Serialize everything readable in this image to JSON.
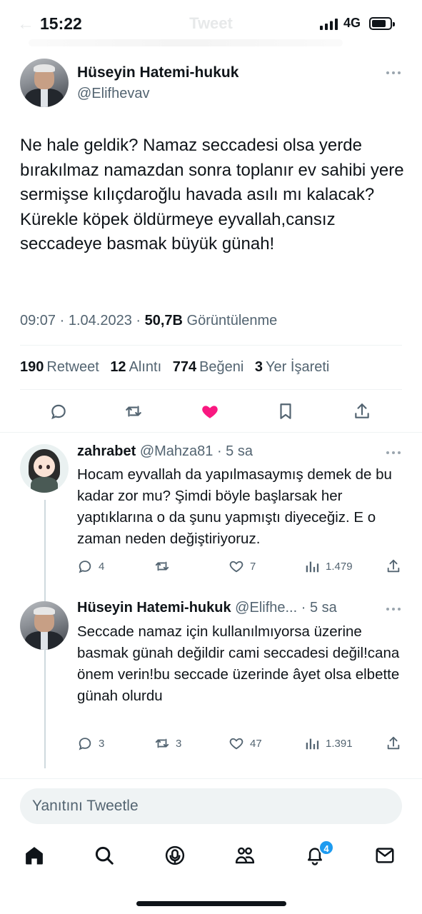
{
  "status_bar": {
    "time": "15:22",
    "network": "4G",
    "ghost_title": "Tweet"
  },
  "tweet": {
    "author_name": "Hüseyin Hatemi-hukuk",
    "author_handle": "@Elifhevav",
    "text": "Ne hale geldik? Namaz seccadesi olsa yerde bırakılmaz namazdan sonra toplanır ev sahibi yere sermişse kılıçdaroğlu havada asılı mı kalacak? Kürekle köpek öldürmeye eyvallah,cansız seccadeye basmak büyük günah!",
    "time": "09:07",
    "date": "1.04.2023",
    "views_count": "50,7B",
    "views_label": "Görüntülenme",
    "retweets_count": "190",
    "retweets_label": "Retweet",
    "quotes_count": "12",
    "quotes_label": "Alıntı",
    "likes_count": "774",
    "likes_label": "Beğeni",
    "bookmarks_count": "3",
    "bookmarks_label": "Yer İşareti"
  },
  "replies": [
    {
      "author_name": "zahrabet",
      "author_handle": "@Mahza81",
      "age": "5 sa",
      "text": "Hocam eyvallah da yapılmasaymış demek de bu kadar zor mu? Şimdi böyle başlarsak her yaptıklarına o da şunu yapmıştı diyeceğiz. E o zaman neden değiştiriyoruz.",
      "replies": "4",
      "retweets": "",
      "likes": "7",
      "views": "1.479"
    },
    {
      "author_name": "Hüseyin Hatemi-hukuk",
      "author_handle": "@Elifhe...",
      "age": "5 sa",
      "text": "Seccade namaz için kullanılmıyorsa üzerine basmak günah değildir cami seccadesi değil!cana önem verin!bu seccade üzerinde âyet olsa elbette günah olurdu",
      "replies": "3",
      "retweets": "3",
      "likes": "47",
      "views": "1.391"
    }
  ],
  "reply_placeholder": "Yanıtını Tweetle",
  "nav": {
    "notifications_badge": "4"
  },
  "colors": {
    "like_active": "#f91880",
    "accent": "#1d9bf0",
    "muted": "#536471"
  }
}
